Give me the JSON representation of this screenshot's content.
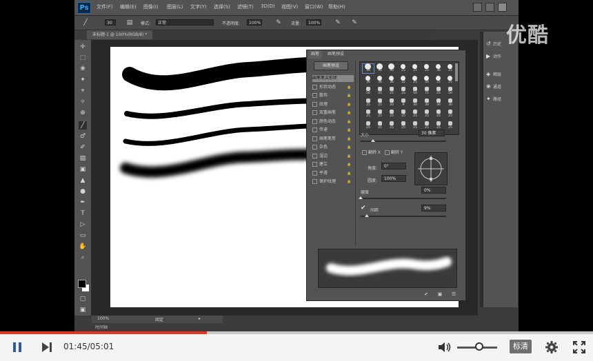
{
  "watermark": {
    "logo_text": "优酷"
  },
  "photoshop": {
    "logo": "Ps",
    "menu": [
      "文件(F)",
      "编辑(E)",
      "图像(I)",
      "图层(L)",
      "文字(Y)",
      "选择(S)",
      "滤镜(T)",
      "3D(D)",
      "视图(V)",
      "窗口(W)",
      "帮助(H)"
    ],
    "options": {
      "brush_size": "30",
      "mode_label": "模式:",
      "mode_value": "正常",
      "opacity_label": "不透明度:",
      "opacity_value": "100%",
      "flow_label": "流量:",
      "flow_value": "100%"
    },
    "document_tab": "未标题-1 @ 100%(RGB/8) *",
    "status": {
      "zoom": "100%",
      "info": "固定"
    },
    "bottom_tab": "时间轴",
    "brush_panel": {
      "tabs": [
        "画笔",
        "画笔预设"
      ],
      "preset_button": "画笔预设",
      "options": [
        {
          "label": "画笔笔尖形状",
          "active": true,
          "checkable": false
        },
        {
          "label": "形状动态",
          "active": false,
          "checkable": true
        },
        {
          "label": "散布",
          "active": false,
          "checkable": true
        },
        {
          "label": "纹理",
          "active": false,
          "checkable": true
        },
        {
          "label": "双重画笔",
          "active": false,
          "checkable": true
        },
        {
          "label": "颜色动态",
          "active": false,
          "checkable": true
        },
        {
          "label": "传递",
          "active": false,
          "checkable": true
        },
        {
          "label": "画笔笔势",
          "active": false,
          "checkable": true
        },
        {
          "label": "杂色",
          "active": false,
          "checkable": true
        },
        {
          "label": "湿边",
          "active": false,
          "checkable": true
        },
        {
          "label": "建立",
          "active": false,
          "checkable": true
        },
        {
          "label": "平滑",
          "active": false,
          "checkable": true
        },
        {
          "label": "保护纹理",
          "active": false,
          "checkable": true
        }
      ],
      "tip_rows": [
        [
          "30",
          "30",
          "30",
          "25",
          "25",
          "25",
          "36",
          "25"
        ],
        [
          "36",
          "36",
          "36",
          "32",
          "25",
          "50",
          "25",
          "25"
        ],
        [
          "50",
          "25",
          "25",
          "25",
          "50",
          "71",
          "25",
          "50"
        ],
        [
          "25",
          "25",
          "20",
          "9",
          "30",
          "30",
          "30",
          "30"
        ],
        [
          "25",
          "25",
          "25",
          "25",
          "25",
          "25",
          "25",
          "25"
        ],
        [
          "25",
          "25",
          "25",
          "25",
          "25",
          "25",
          "25",
          "25"
        ]
      ],
      "size_label": "大小",
      "size_value": "30 像素",
      "flip_x": "翻转 X",
      "flip_y": "翻转 Y",
      "angle_label": "角度:",
      "angle_value": "0°",
      "roundness_label": "圆度:",
      "roundness_value": "100%",
      "hardness_label": "硬度",
      "hardness_value": "0%",
      "spacing_label": "间距",
      "spacing_value": "9%",
      "spacing_checked": true
    },
    "right_dock": [
      {
        "icon": "history-icon",
        "label": "历史"
      },
      {
        "icon": "actions-icon",
        "label": "动作"
      },
      {
        "icon": "layers-icon",
        "label": "图层"
      },
      {
        "icon": "channels-icon",
        "label": "通道"
      },
      {
        "icon": "paths-icon",
        "label": "路径"
      }
    ]
  },
  "player": {
    "time_current": "01:45",
    "time_total": "05:01",
    "time_display": "01:45/05:01",
    "progress": 0.349,
    "volume": 0.55,
    "quality_label": "标清"
  },
  "colors": {
    "accent_progress": "#e8331d",
    "control_blue": "#2b5aa0",
    "ps_dark": "#3c3c3c",
    "ps_panel": "#535353"
  }
}
